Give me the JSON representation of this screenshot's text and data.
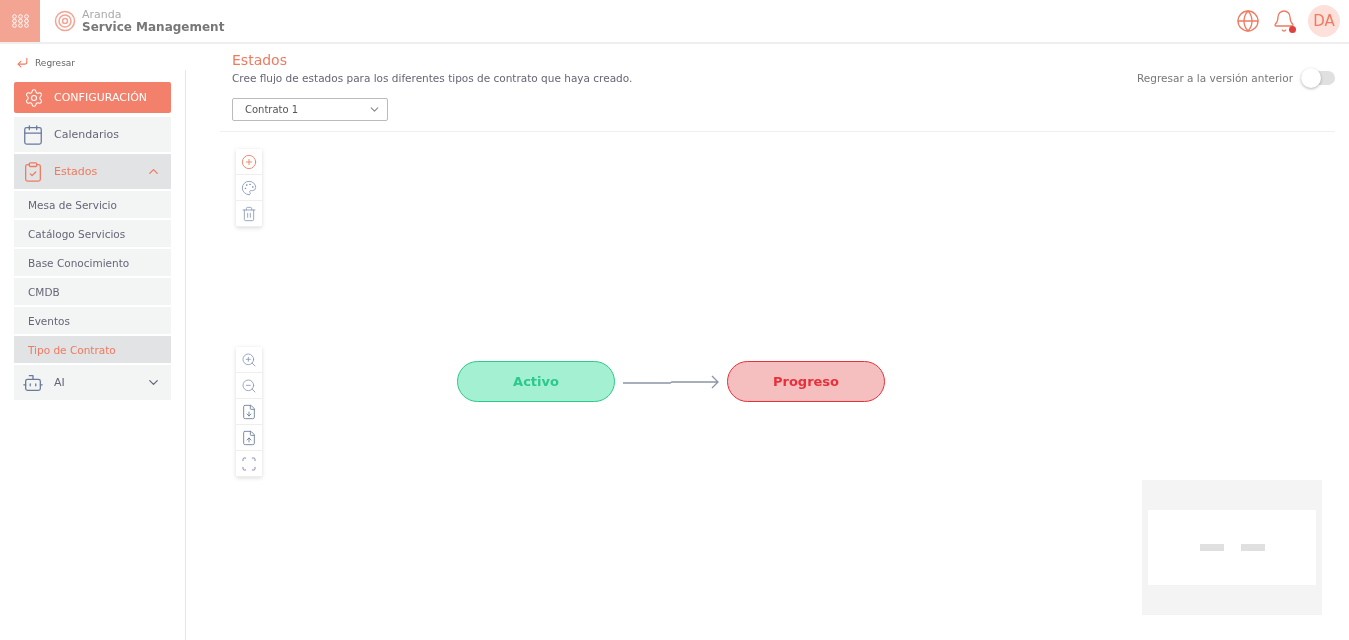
{
  "header": {
    "brand_top": "Aranda",
    "brand_bottom": "Service Management",
    "avatar": "DA",
    "has_notifications": true
  },
  "sidebar": {
    "back": "Regresar",
    "section": "CONFIGURACIÓN",
    "items": [
      {
        "label": "Calendarios",
        "kind": "calendar",
        "expanded": false
      },
      {
        "label": "Estados",
        "kind": "states",
        "expanded": true,
        "children": [
          {
            "label": "Mesa de Servicio",
            "selected": false
          },
          {
            "label": "Catálogo Servicios",
            "selected": false
          },
          {
            "label": "Base Conocimiento",
            "selected": false
          },
          {
            "label": "CMDB",
            "selected": false
          },
          {
            "label": "Eventos",
            "selected": false
          },
          {
            "label": "Tipo de Contrato",
            "selected": true
          }
        ]
      },
      {
        "label": "AI",
        "kind": "ai",
        "expanded": false
      }
    ]
  },
  "main": {
    "title": "Estados",
    "subtitle": "Cree flujo de estados para los diferentes tipos de contrato que haya creado.",
    "toggle": {
      "label": "Regresar a la versión anterior",
      "on": false
    },
    "contract_select": {
      "value": "Contrato 1"
    }
  },
  "diagram": {
    "nodes": [
      {
        "label": "Activo",
        "color": "#a3f0d3"
      },
      {
        "label": "Progreso",
        "color": "#f5bfc0"
      }
    ]
  }
}
